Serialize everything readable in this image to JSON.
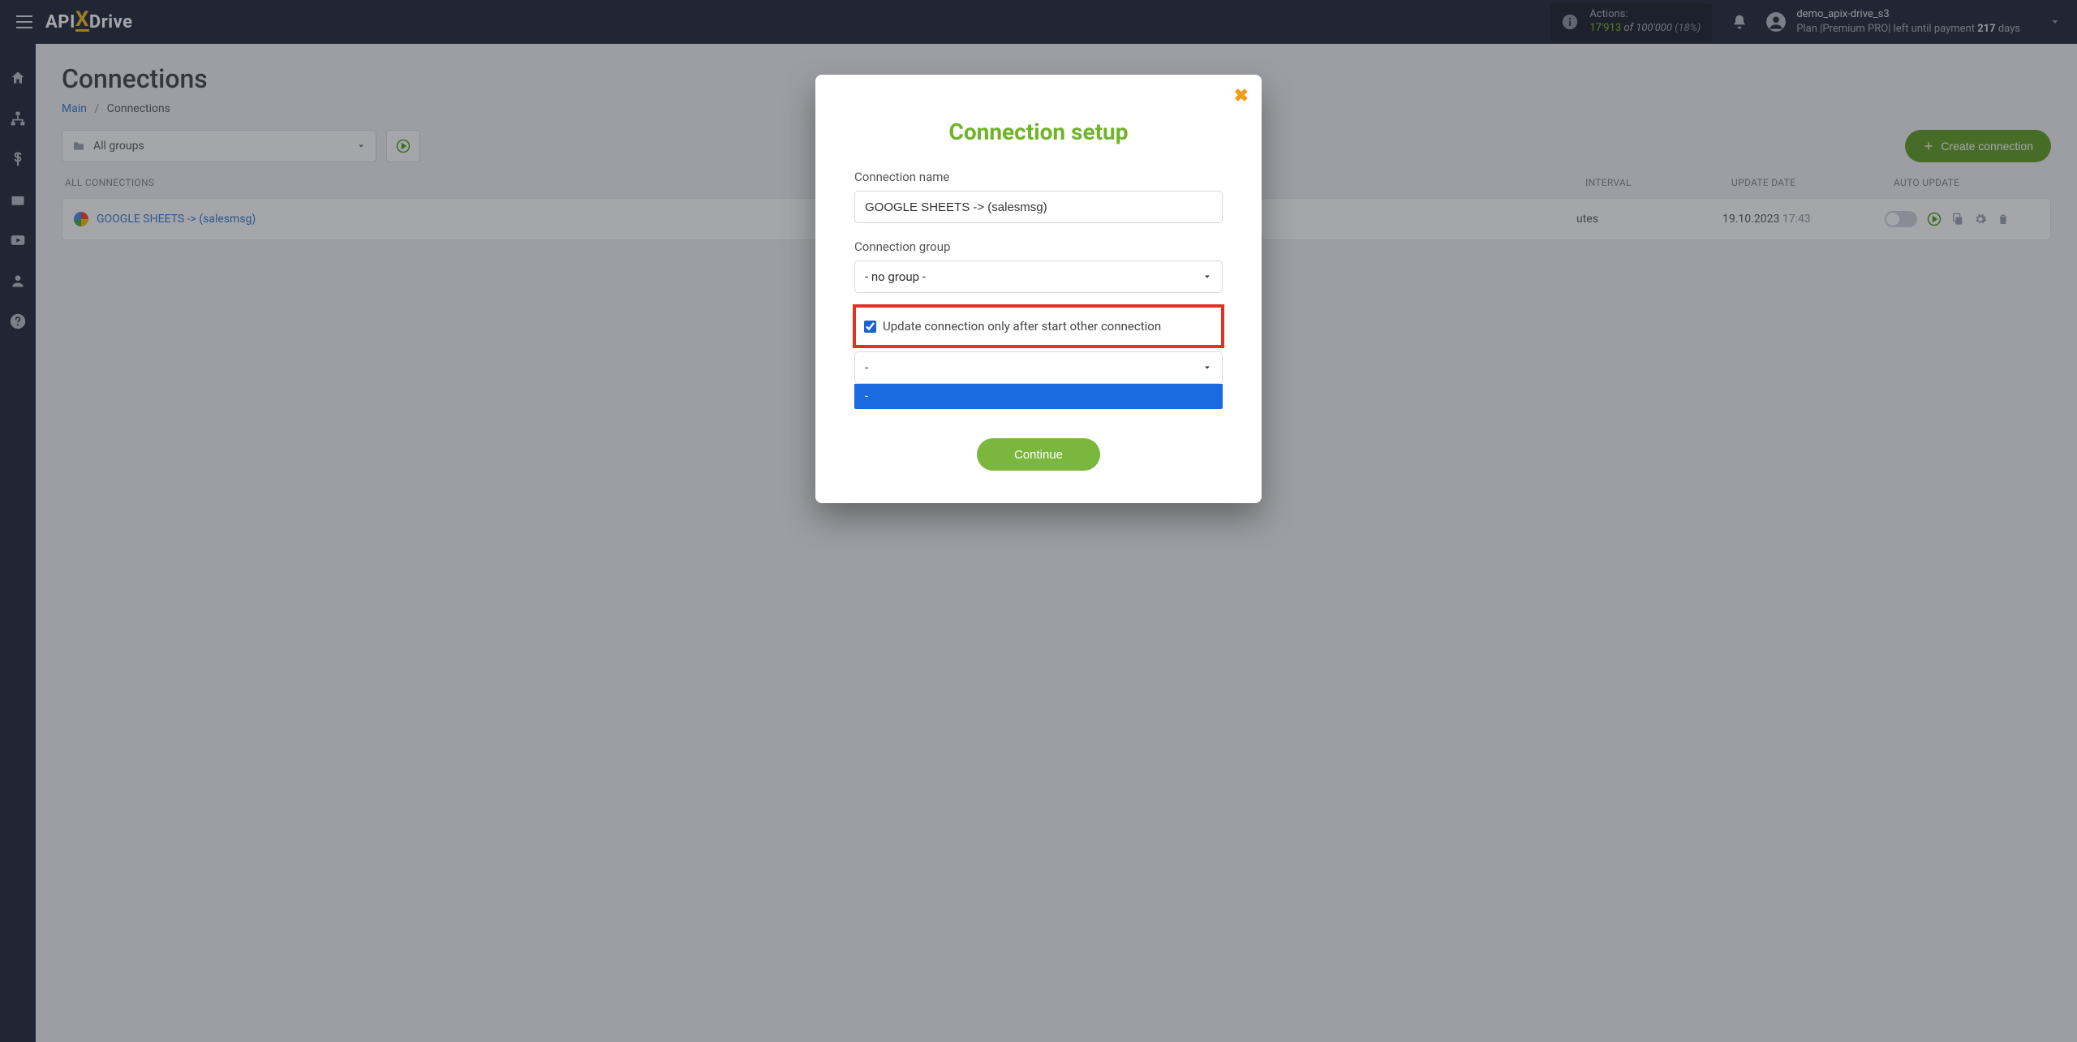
{
  "header": {
    "logo": {
      "p1": "API",
      "p2": "X",
      "p3": "Drive"
    },
    "actions": {
      "label": "Actions:",
      "count": "17'913",
      "of": "of",
      "total": "100'000",
      "pct": "(18%)"
    },
    "user": {
      "name": "demo_apix-drive_s3",
      "plan_prefix": "Plan |",
      "plan_name": "Premium PRO",
      "plan_mid": "| left until payment ",
      "days": "217",
      "days_suffix": " days"
    }
  },
  "page": {
    "title": "Connections",
    "breadcrumb": {
      "main": "Main",
      "current": "Connections"
    },
    "groups_placeholder": "All groups",
    "create_button": "Create connection",
    "table": {
      "head_name": "ALL CONNECTIONS",
      "head_interval": "INTERVAL",
      "head_update": "UPDATE DATE",
      "head_auto": "AUTO UPDATE"
    },
    "row": {
      "name": "GOOGLE SHEETS -> (salesmsg)",
      "interval": "utes",
      "update_date": "19.10.2023",
      "update_time": "17:43"
    }
  },
  "modal": {
    "title": "Connection setup",
    "name_label": "Connection name",
    "name_value": "GOOGLE SHEETS -> (salesmsg)",
    "group_label": "Connection group",
    "group_value": "- no group -",
    "checkbox_label": "Update connection only after start other connection",
    "dep_conn_value": "-",
    "dropdown_option": "-",
    "continue": "Continue"
  }
}
